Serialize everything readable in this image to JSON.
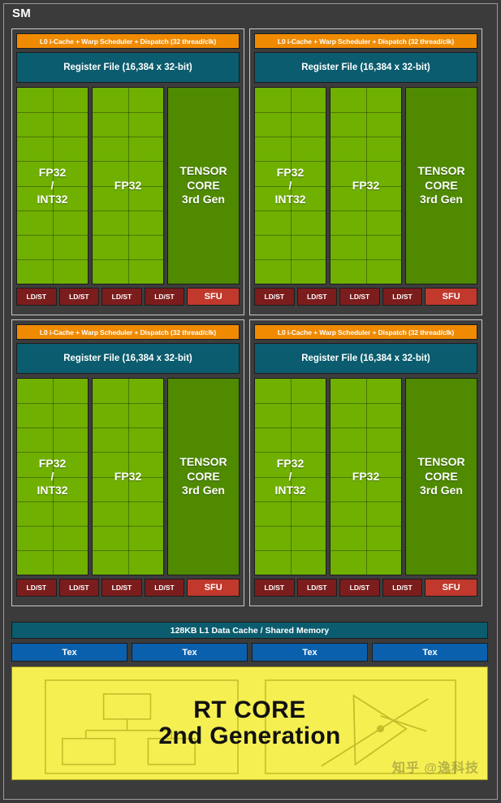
{
  "diagram": {
    "title": "SM",
    "accent_colors": {
      "scheduler_orange": "#f08a00",
      "register_teal": "#0a5c6e",
      "fp32_green": "#6fb000",
      "tensor_green": "#4f8a00",
      "ldst_maroon": "#7b1d1d",
      "sfu_red": "#c1392c",
      "tex_blue": "#0b60ad",
      "rtcore_yellow": "#f5ef52",
      "background_gray": "#3b3b3b"
    }
  },
  "processing_blocks": [
    {
      "scheduler": "L0 i-Cache + Warp Scheduler + Dispatch (32 thread/clk)",
      "register_file": "Register File (16,384 x 32-bit)",
      "columns": [
        {
          "name": "fp32-int32-column",
          "label": "FP32\n/\nINT32",
          "lines": [
            "FP32",
            "/",
            "INT32"
          ],
          "type": "fp32"
        },
        {
          "name": "fp32-column",
          "label": "FP32",
          "lines": [
            "FP32"
          ],
          "type": "fp32"
        },
        {
          "name": "tensor-core-column",
          "label": "TENSOR CORE 3rd Gen",
          "lines": [
            "TENSOR",
            "CORE",
            "3rd Gen"
          ],
          "type": "tensor"
        }
      ],
      "lsu": [
        "LD/ST",
        "LD/ST",
        "LD/ST",
        "LD/ST"
      ],
      "sfu": "SFU"
    },
    {
      "scheduler": "L0 i-Cache + Warp Scheduler + Dispatch (32 thread/clk)",
      "register_file": "Register File (16,384 x 32-bit)",
      "columns": [
        {
          "name": "fp32-int32-column",
          "label": "FP32\n/\nINT32",
          "lines": [
            "FP32",
            "/",
            "INT32"
          ],
          "type": "fp32"
        },
        {
          "name": "fp32-column",
          "label": "FP32",
          "lines": [
            "FP32"
          ],
          "type": "fp32"
        },
        {
          "name": "tensor-core-column",
          "label": "TENSOR CORE 3rd Gen",
          "lines": [
            "TENSOR",
            "CORE",
            "3rd Gen"
          ],
          "type": "tensor"
        }
      ],
      "lsu": [
        "LD/ST",
        "LD/ST",
        "LD/ST",
        "LD/ST"
      ],
      "sfu": "SFU"
    },
    {
      "scheduler": "L0 i-Cache + Warp Scheduler + Dispatch (32 thread/clk)",
      "register_file": "Register File (16,384 x 32-bit)",
      "columns": [
        {
          "name": "fp32-int32-column",
          "label": "FP32\n/\nINT32",
          "lines": [
            "FP32",
            "/",
            "INT32"
          ],
          "type": "fp32"
        },
        {
          "name": "fp32-column",
          "label": "FP32",
          "lines": [
            "FP32"
          ],
          "type": "fp32"
        },
        {
          "name": "tensor-core-column",
          "label": "TENSOR CORE 3rd Gen",
          "lines": [
            "TENSOR",
            "CORE",
            "3rd Gen"
          ],
          "type": "tensor"
        }
      ],
      "lsu": [
        "LD/ST",
        "LD/ST",
        "LD/ST",
        "LD/ST"
      ],
      "sfu": "SFU"
    },
    {
      "scheduler": "L0 i-Cache + Warp Scheduler + Dispatch (32 thread/clk)",
      "register_file": "Register File (16,384 x 32-bit)",
      "columns": [
        {
          "name": "fp32-int32-column",
          "label": "FP32\n/\nINT32",
          "lines": [
            "FP32",
            "/",
            "INT32"
          ],
          "type": "fp32"
        },
        {
          "name": "fp32-column",
          "label": "FP32",
          "lines": [
            "FP32"
          ],
          "type": "fp32"
        },
        {
          "name": "tensor-core-column",
          "label": "TENSOR CORE 3rd Gen",
          "lines": [
            "TENSOR",
            "CORE",
            "3rd Gen"
          ],
          "type": "tensor"
        }
      ],
      "lsu": [
        "LD/ST",
        "LD/ST",
        "LD/ST",
        "LD/ST"
      ],
      "sfu": "SFU"
    }
  ],
  "l1_cache": "128KB L1 Data Cache / Shared Memory",
  "tex_units": [
    "Tex",
    "Tex",
    "Tex",
    "Tex"
  ],
  "rt_core": {
    "line1": "RT CORE",
    "line2": "2nd Generation"
  },
  "watermark": "知乎 @逸科技"
}
